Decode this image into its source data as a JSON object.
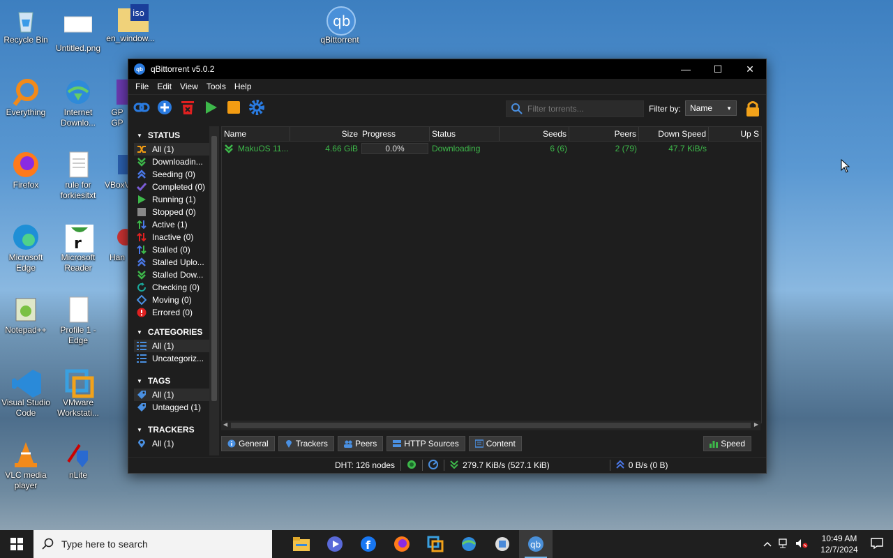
{
  "desktop": {
    "icons": [
      {
        "label": "Recycle Bin"
      },
      {
        "label": "Untitled.png"
      },
      {
        "label": "en_window..."
      },
      {
        "label": "qBittorrent"
      },
      {
        "label": "Everything"
      },
      {
        "label": "Internet Downlo..."
      },
      {
        "label": "GP GP"
      },
      {
        "label": "Firefox"
      },
      {
        "label": "rule for forkiesitxt"
      },
      {
        "label": "VBoxV"
      },
      {
        "label": "Microsoft Edge"
      },
      {
        "label": "Microsoft Reader"
      },
      {
        "label": "Han"
      },
      {
        "label": "Notepad++"
      },
      {
        "label": "Profile 1 - Edge"
      },
      {
        "label": "Visual Studio Code"
      },
      {
        "label": "VMware Workstati..."
      },
      {
        "label": "VLC media player"
      },
      {
        "label": "nLite"
      }
    ]
  },
  "window": {
    "title": "qBittorrent v5.0.2",
    "app_icon_text": "qb",
    "controls": {
      "minimize": "—",
      "maximize": "☐",
      "close": "✕"
    }
  },
  "menu": [
    "File",
    "Edit",
    "View",
    "Tools",
    "Help"
  ],
  "filter": {
    "placeholder": "Filter torrents...",
    "label": "Filter by:",
    "selected": "Name"
  },
  "sidebar": {
    "status_title": "STATUS",
    "status_items": [
      {
        "label": "All (1)"
      },
      {
        "label": "Downloadin..."
      },
      {
        "label": "Seeding (0)"
      },
      {
        "label": "Completed (0)"
      },
      {
        "label": "Running (1)"
      },
      {
        "label": "Stopped (0)"
      },
      {
        "label": "Active (1)"
      },
      {
        "label": "Inactive (0)"
      },
      {
        "label": "Stalled (0)"
      },
      {
        "label": "Stalled Uplo..."
      },
      {
        "label": "Stalled Dow..."
      },
      {
        "label": "Checking (0)"
      },
      {
        "label": "Moving (0)"
      },
      {
        "label": "Errored (0)"
      }
    ],
    "categories_title": "CATEGORIES",
    "categories_items": [
      {
        "label": "All (1)"
      },
      {
        "label": "Uncategoriz..."
      }
    ],
    "tags_title": "TAGS",
    "tags_items": [
      {
        "label": "All (1)"
      },
      {
        "label": "Untagged (1)"
      }
    ],
    "trackers_title": "TRACKERS",
    "trackers_items": [
      {
        "label": "All (1)"
      }
    ]
  },
  "table": {
    "columns": [
      "Name",
      "Size",
      "Progress",
      "Status",
      "Seeds",
      "Peers",
      "Down Speed",
      "Up S"
    ],
    "rows": [
      {
        "name": "MakuOS 11...",
        "size": "4.66 GiB",
        "progress": "0.0%",
        "status": "Downloading",
        "seeds": "6 (6)",
        "peers": "2 (79)",
        "down_speed": "47.7 KiB/s",
        "up_speed": ""
      }
    ]
  },
  "tabs": [
    "General",
    "Trackers",
    "Peers",
    "HTTP Sources",
    "Content"
  ],
  "speed_tab": "Speed",
  "statusbar": {
    "dht": "DHT: 126 nodes",
    "down": "279.7 KiB/s (527.1 KiB)",
    "up": "0 B/s (0 B)"
  },
  "taskbar": {
    "search_placeholder": "Type here to search",
    "time": "10:49 AM",
    "date": "12/7/2024"
  },
  "colors": {
    "accent_green": "#3db84a",
    "toolbar_blue": "#2a7be0",
    "delete_red": "#e02020",
    "stop_orange": "#f39c12"
  }
}
